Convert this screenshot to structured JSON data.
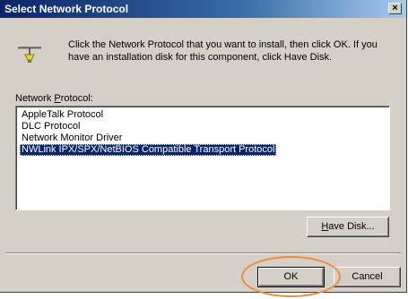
{
  "window": {
    "title": "Select Network Protocol",
    "close_glyph": "×"
  },
  "icons": {
    "network": "network-protocol-icon",
    "close": "close-icon"
  },
  "instructions": "Click the Network Protocol that you want to install, then click OK. If you have an installation disk for this component, click Have Disk.",
  "list": {
    "label_prefix": "Network ",
    "label_accel": "P",
    "label_suffix": "rotocol:",
    "items": [
      "AppleTalk Protocol",
      "DLC Protocol",
      "Network Monitor Driver",
      "NWLink IPX/SPX/NetBIOS Compatible Transport Protocol"
    ],
    "selected_index": 3
  },
  "buttons": {
    "have_disk_accel": "H",
    "have_disk_rest": "ave Disk...",
    "ok": "OK",
    "cancel": "Cancel"
  },
  "colors": {
    "titlebar_start": "#0a246a",
    "titlebar_end": "#a6caf0",
    "dialog_face": "#d4d0c8",
    "selection": "#0a246a",
    "highlight_circle": "#f08a3c"
  }
}
